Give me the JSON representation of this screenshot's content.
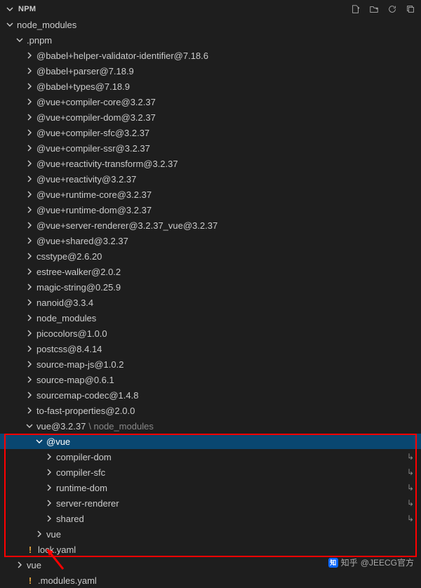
{
  "header": {
    "title": "NPM"
  },
  "tree": {
    "root": {
      "label": "node_modules"
    },
    "pnpm": {
      "label": ".pnpm"
    },
    "pnpm_children": [
      "@babel+helper-validator-identifier@7.18.6",
      "@babel+parser@7.18.9",
      "@babel+types@7.18.9",
      "@vue+compiler-core@3.2.37",
      "@vue+compiler-dom@3.2.37",
      "@vue+compiler-sfc@3.2.37",
      "@vue+compiler-ssr@3.2.37",
      "@vue+reactivity-transform@3.2.37",
      "@vue+reactivity@3.2.37",
      "@vue+runtime-core@3.2.37",
      "@vue+runtime-dom@3.2.37",
      "@vue+server-renderer@3.2.37_vue@3.2.37",
      "@vue+shared@3.2.37",
      "csstype@2.6.20",
      "estree-walker@2.0.2",
      "magic-string@0.25.9",
      "nanoid@3.3.4",
      "node_modules",
      "picocolors@1.0.0",
      "postcss@8.4.14",
      "source-map-js@1.0.2",
      "source-map@0.6.1",
      "sourcemap-codec@1.4.8",
      "to-fast-properties@2.0.0"
    ],
    "vue_pkg": {
      "label": "vue@3.2.37",
      "suffix": "\\ node_modules"
    },
    "at_vue": {
      "label": "@vue"
    },
    "at_vue_children": [
      "compiler-dom",
      "compiler-sfc",
      "runtime-dom",
      "server-renderer",
      "shared"
    ],
    "vue_folder": {
      "label": "vue"
    },
    "lock": {
      "label": "lock.yaml"
    },
    "vue_link": {
      "label": "vue"
    },
    "modules": {
      "label": ".modules.yaml"
    }
  },
  "watermark": {
    "prefix": "知乎",
    "text": "@JEECG官方"
  }
}
